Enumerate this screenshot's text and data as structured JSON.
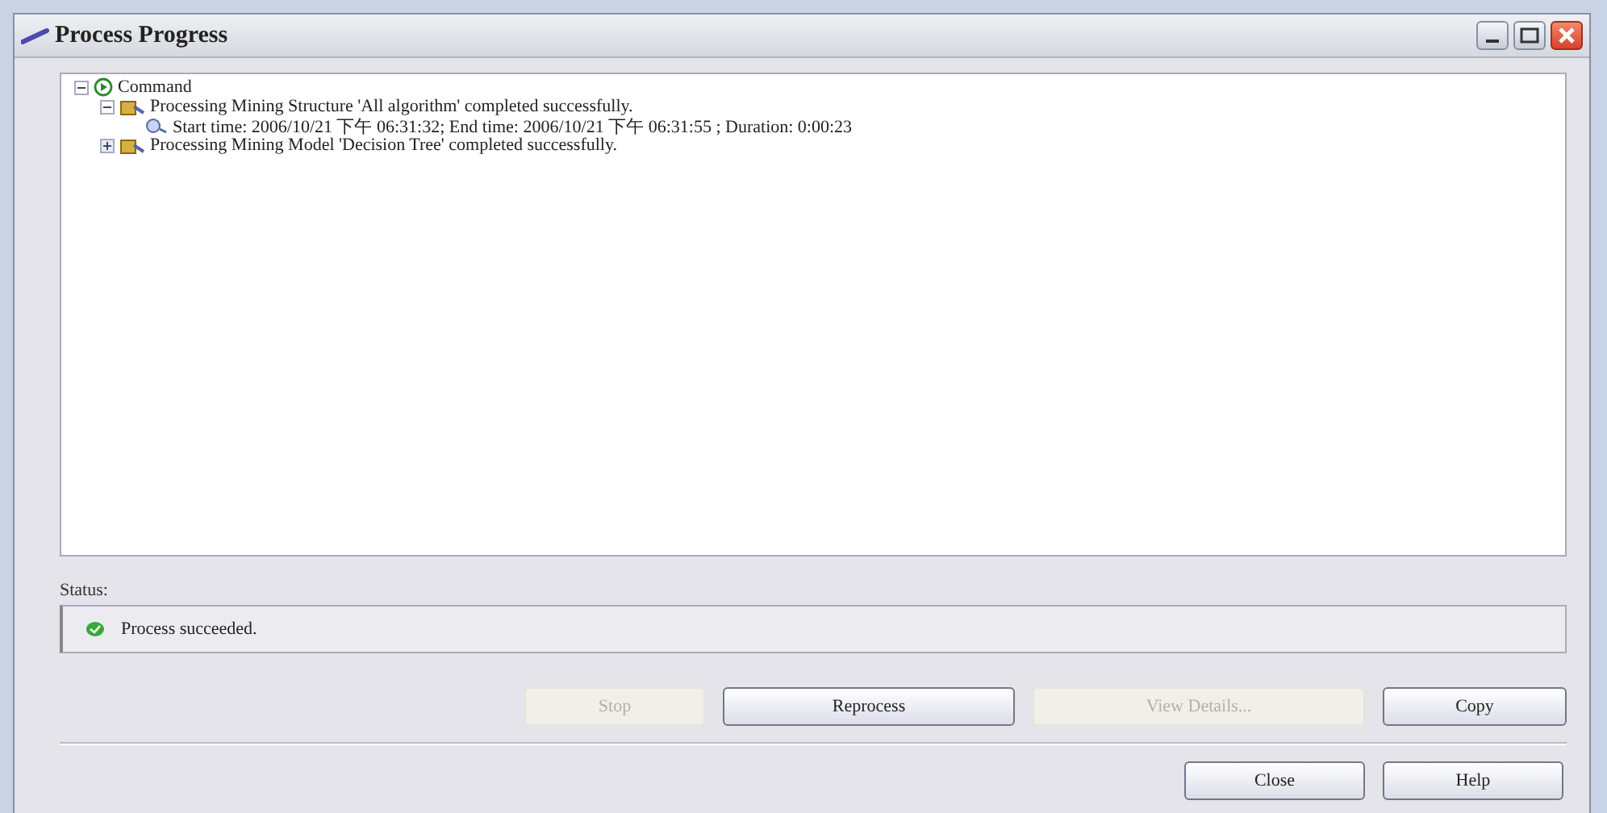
{
  "window": {
    "title": "Process Progress"
  },
  "tree": [
    {
      "kind": "command",
      "label": "Command",
      "expanded": true,
      "children": [
        {
          "kind": "structure",
          "label": "Processing Mining Structure 'All algorithm' completed successfully.",
          "expanded": true,
          "children": [
            {
              "kind": "time",
              "label": "Start time: 2006/10/21 下午 06:31:32; End time: 2006/10/21 下午 06:31:55 ; Duration: 0:00:23"
            }
          ]
        },
        {
          "kind": "structure",
          "label": "Processing Mining Model 'Decision Tree' completed successfully.",
          "expanded": false
        }
      ]
    }
  ],
  "status": {
    "label": "Status:",
    "message": "Process succeeded."
  },
  "buttons": [
    {
      "label": "Stop",
      "disabled": true
    },
    {
      "label": "Reprocess",
      "disabled": false
    },
    {
      "label": "View Details...",
      "disabled": true
    },
    {
      "label": "Copy",
      "disabled": false
    }
  ],
  "footer_buttons": [
    {
      "label": "Close",
      "disabled": false
    },
    {
      "label": "Help",
      "disabled": false
    }
  ]
}
